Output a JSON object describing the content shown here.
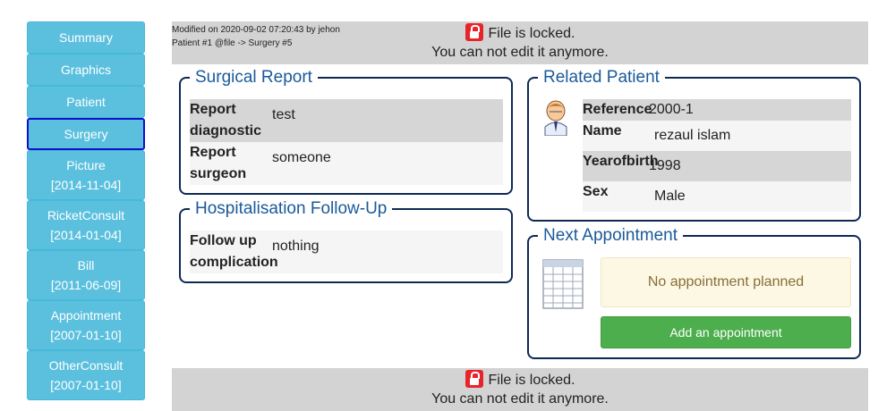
{
  "sidebar": {
    "items": [
      {
        "label": "Summary",
        "date": ""
      },
      {
        "label": "Graphics",
        "date": ""
      },
      {
        "label": "Patient",
        "date": ""
      },
      {
        "label": "Surgery",
        "date": ""
      },
      {
        "label": "Picture",
        "date": "[2014-11-04]"
      },
      {
        "label": "RicketConsult",
        "date": "[2014-01-04]"
      },
      {
        "label": "Bill",
        "date": "[2011-06-09]"
      },
      {
        "label": "Appointment",
        "date": "[2007-01-10]"
      },
      {
        "label": "OtherConsult",
        "date": "[2007-01-10]"
      }
    ],
    "active": "Surgery"
  },
  "header": {
    "modified": "Modified on 2020-09-02 07:20:43 by jehon",
    "breadcrumb": "Patient #1 @file -> Surgery #5",
    "locked": "File is locked.",
    "no_edit": "You can not edit it anymore."
  },
  "footer": {
    "locked": "File is locked.",
    "no_edit": "You can not edit it anymore."
  },
  "surgical_report": {
    "title": "Surgical Report",
    "rows": [
      {
        "key_line1": "Report",
        "key_line2": "diagnostic",
        "value": "test"
      },
      {
        "key_line1": "Report",
        "key_line2": "surgeon",
        "value": "someone"
      }
    ]
  },
  "hospitalisation": {
    "title": "Hospitalisation Follow-Up",
    "rows": [
      {
        "key_line1": "Follow up",
        "key_line2": "complication",
        "value": "nothing"
      }
    ]
  },
  "patient": {
    "title": "Related Patient",
    "rows": [
      {
        "key": "Reference",
        "value": "2000-1"
      },
      {
        "key": "Name",
        "value": "rezaul islam"
      },
      {
        "key": "Yearofbirth",
        "value": "1998"
      },
      {
        "key": "Sex",
        "value": "Male"
      }
    ]
  },
  "appointment": {
    "title": "Next Appointment",
    "empty_text": "No appointment planned",
    "add_label": "Add an appointment"
  },
  "colors": {
    "nav_bg": "#5bc0de",
    "active_border": "#1010cc",
    "banner_bg": "#d3d3d3",
    "legend_text": "#1a5a9a",
    "panel_border": "#0d2a55",
    "button_green": "#4cae4c",
    "warning_bg": "#fcf8e3",
    "lock_red": "#e8242b"
  }
}
